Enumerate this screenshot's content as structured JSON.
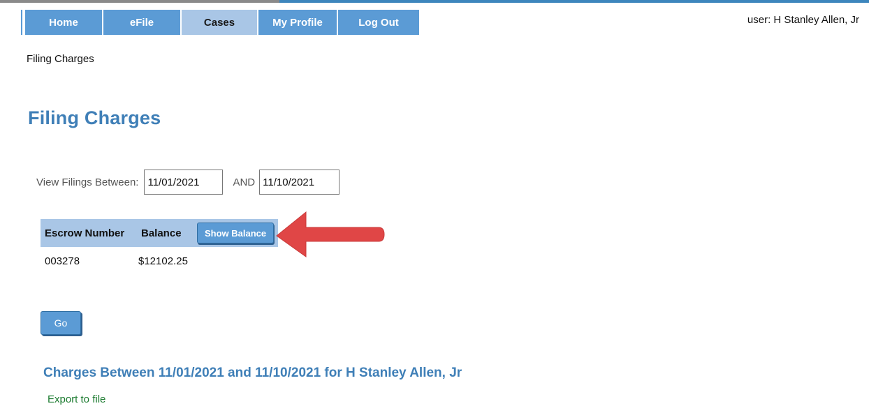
{
  "nav": {
    "items": [
      {
        "label": "Home",
        "active": false
      },
      {
        "label": "eFile",
        "active": false
      },
      {
        "label": "Cases",
        "active": true
      },
      {
        "label": "My Profile",
        "active": false
      },
      {
        "label": "Log Out",
        "active": false
      }
    ]
  },
  "user_label": "user: H Stanley Allen, Jr",
  "breadcrumb": "Filing Charges",
  "page_title": "Filing Charges",
  "filter": {
    "label": "View Filings Between:",
    "from_value": "11/01/2021",
    "and_label": "AND",
    "to_value": "11/10/2021"
  },
  "escrow": {
    "headers": [
      "Escrow Number",
      "Balance"
    ],
    "show_balance_label": "Show Balance",
    "rows": [
      {
        "number": "003278",
        "balance": "$12102.25"
      }
    ]
  },
  "go_label": "Go",
  "charges_heading": "Charges Between 11/01/2021 and 11/10/2021 for H Stanley Allen, Jr",
  "export_label": "Export to file",
  "colors": {
    "nav_blue": "#5b9bd5",
    "nav_active": "#a9c6e6",
    "title_blue": "#3f7fb7",
    "arrow_red": "#e04646",
    "link_green": "#1a7a2e"
  }
}
